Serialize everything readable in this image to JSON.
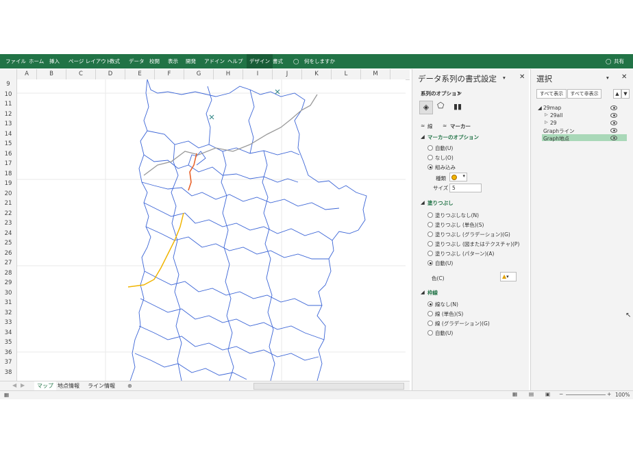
{
  "ribbon": {
    "tabs": [
      "ファイル",
      "ホーム",
      "挿入",
      "ページ レイアウト",
      "数式",
      "データ",
      "校閲",
      "表示",
      "開発",
      "アドイン",
      "ヘルプ",
      "デザイン",
      "書式"
    ],
    "tell_me": "何をしますか",
    "share": "共有"
  },
  "columns": [
    "A",
    "B",
    "C",
    "D",
    "E",
    "F",
    "G",
    "H",
    "I",
    "J",
    "K",
    "L",
    "M"
  ],
  "rows": [
    "9",
    "10",
    "11",
    "12",
    "13",
    "14",
    "15",
    "16",
    "17",
    "18",
    "19",
    "20",
    "21",
    "22",
    "23",
    "24",
    "25",
    "26",
    "27",
    "28",
    "29",
    "30",
    "31",
    "32",
    "33",
    "34",
    "35",
    "36",
    "37",
    "38"
  ],
  "sheet_tabs": [
    "マップ",
    "地点情報",
    "ライン情報"
  ],
  "status": {
    "zoom": "100%"
  },
  "format_pane": {
    "title": "データ系列の書式設定",
    "series_options": "系列のオプション",
    "subtabs": [
      "線",
      "マーカー"
    ],
    "marker_options": {
      "header": "マーカーのオプション",
      "options": [
        "自動(U)",
        "なし(O)",
        "組み込み"
      ],
      "type_label": "種類",
      "size_label": "サイズ",
      "size_value": "5"
    },
    "fill": {
      "header": "塗りつぶし",
      "options": [
        "塗りつぶしなし(N)",
        "塗りつぶし (単色)(S)",
        "塗りつぶし (グラデーション)(G)",
        "塗りつぶし (図またはテクスチャ)(P)",
        "塗りつぶし (パターン)(A)",
        "自動(U)"
      ],
      "color_label": "色(C)"
    },
    "border": {
      "header": "枠線",
      "options": [
        "線なし(N)",
        "線 (単色)(S)",
        "線 (グラデーション)(G)",
        "自動(U)"
      ]
    }
  },
  "selection_pane": {
    "title": "選択",
    "show_all": "すべて表示",
    "hide_all": "すべて非表示",
    "items": [
      "29map",
      "29all",
      "29",
      "Graphライン",
      "Graph地点"
    ]
  },
  "colors": {
    "excel_green": "#217346",
    "selected_item": "#a9d8b8",
    "route_orange": "#e8632b",
    "route_yellow": "#f0b400",
    "border_blue": "#3a64d6"
  }
}
